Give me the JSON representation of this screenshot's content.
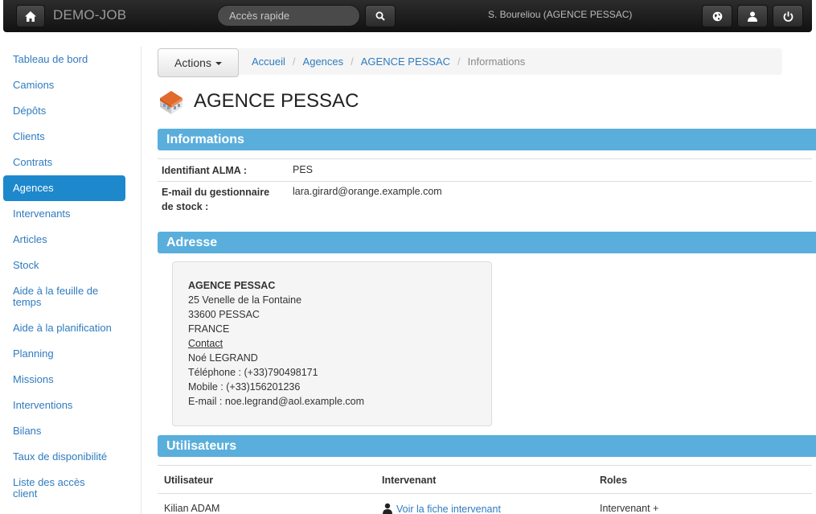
{
  "navbar": {
    "brand": "DEMO-JOB",
    "search_placeholder": "Accès rapide",
    "user": "S. Boureliou (AGENCE PESSAC)",
    "icons": [
      "home-icon",
      "search-icon",
      "globe-icon",
      "user-icon",
      "power-icon"
    ]
  },
  "sidebar": {
    "items": [
      {
        "label": "Tableau de bord"
      },
      {
        "label": "Camions"
      },
      {
        "label": "Dépôts"
      },
      {
        "label": "Clients"
      },
      {
        "label": "Contrats"
      },
      {
        "label": "Agences"
      },
      {
        "label": "Intervenants"
      },
      {
        "label": "Articles"
      },
      {
        "label": "Stock"
      },
      {
        "label": "Aide à la feuille de temps"
      },
      {
        "label": "Aide à la planification"
      },
      {
        "label": "Planning"
      },
      {
        "label": "Missions"
      },
      {
        "label": "Interventions"
      },
      {
        "label": "Bilans"
      },
      {
        "label": "Taux de disponibilité"
      },
      {
        "label": "Liste des accès client"
      }
    ],
    "active": "Agences"
  },
  "toolbar": {
    "actions_label": "Actions"
  },
  "breadcrumb": [
    "Accueil",
    "Agences",
    "AGENCE PESSAC",
    "Informations"
  ],
  "page": {
    "title": "AGENCE PESSAC"
  },
  "sections": {
    "informations": "Informations",
    "adresse": "Adresse",
    "utilisateurs": "Utilisateurs"
  },
  "informations": {
    "id_label": "Identifiant ALMA :",
    "id_value": "PES",
    "email_label": "E-mail du gestionnaire de stock :",
    "email_value": "lara.girard@orange.example.com"
  },
  "adresse": {
    "name": "AGENCE PESSAC",
    "street": "25 Venelle de la Fontaine",
    "city": "33600 PESSAC",
    "country": "FRANCE",
    "contact_label": "Contact",
    "contact_name": "Noé LEGRAND",
    "phone": "Téléphone : (+33)790498171",
    "mobile": "Mobile : (+33)156201236",
    "email": "E-mail : noe.legrand@aol.example.com"
  },
  "users_table": {
    "headers": [
      "Utilisateur",
      "Intervenant",
      "Roles"
    ],
    "rows": [
      {
        "user": "Kilian ADAM",
        "intervenant": "Voir la fiche intervenant",
        "roles": "Intervenant +"
      }
    ]
  },
  "colors": {
    "section_header": "#5aaedc",
    "active_sidebar": "#1e88cc",
    "link": "#2f7bbf"
  }
}
